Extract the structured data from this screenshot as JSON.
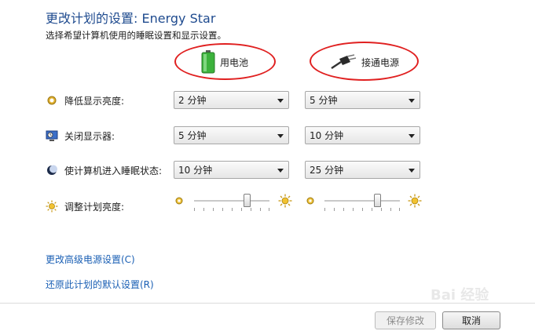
{
  "header": {
    "title": "更改计划的设置: Energy Star",
    "subtitle": "选择希望计算机使用的睡眠设置和显示设置。"
  },
  "columns": {
    "battery": {
      "label": "用电池",
      "icon": "battery-icon"
    },
    "plugged": {
      "label": "接通电源",
      "icon": "power-plug-icon"
    }
  },
  "settings": [
    {
      "label": "降低显示亮度:",
      "icon": "dim-display-icon",
      "battery": "2 分钟",
      "plugged": "5 分钟"
    },
    {
      "label": "关闭显示器:",
      "icon": "display-off-icon",
      "battery": "5 分钟",
      "plugged": "10 分钟"
    },
    {
      "label": "使计算机进入睡眠状态:",
      "icon": "sleep-moon-icon",
      "battery": "10 分钟",
      "plugged": "25 分钟"
    }
  ],
  "brightness": {
    "label": "调整计划亮度:",
    "icon": "brightness-sun-icon",
    "battery_level": 0.7,
    "plugged_level": 0.7
  },
  "links": {
    "advanced": "更改高级电源设置(C)",
    "restore": "还原此计划的默认设置(R)"
  },
  "buttons": {
    "save": "保存修改",
    "cancel": "取消"
  },
  "watermark": "Bai 经验",
  "colors": {
    "title": "#1f4b8f",
    "link": "#1a5fb4",
    "annotation": "#e02020"
  }
}
